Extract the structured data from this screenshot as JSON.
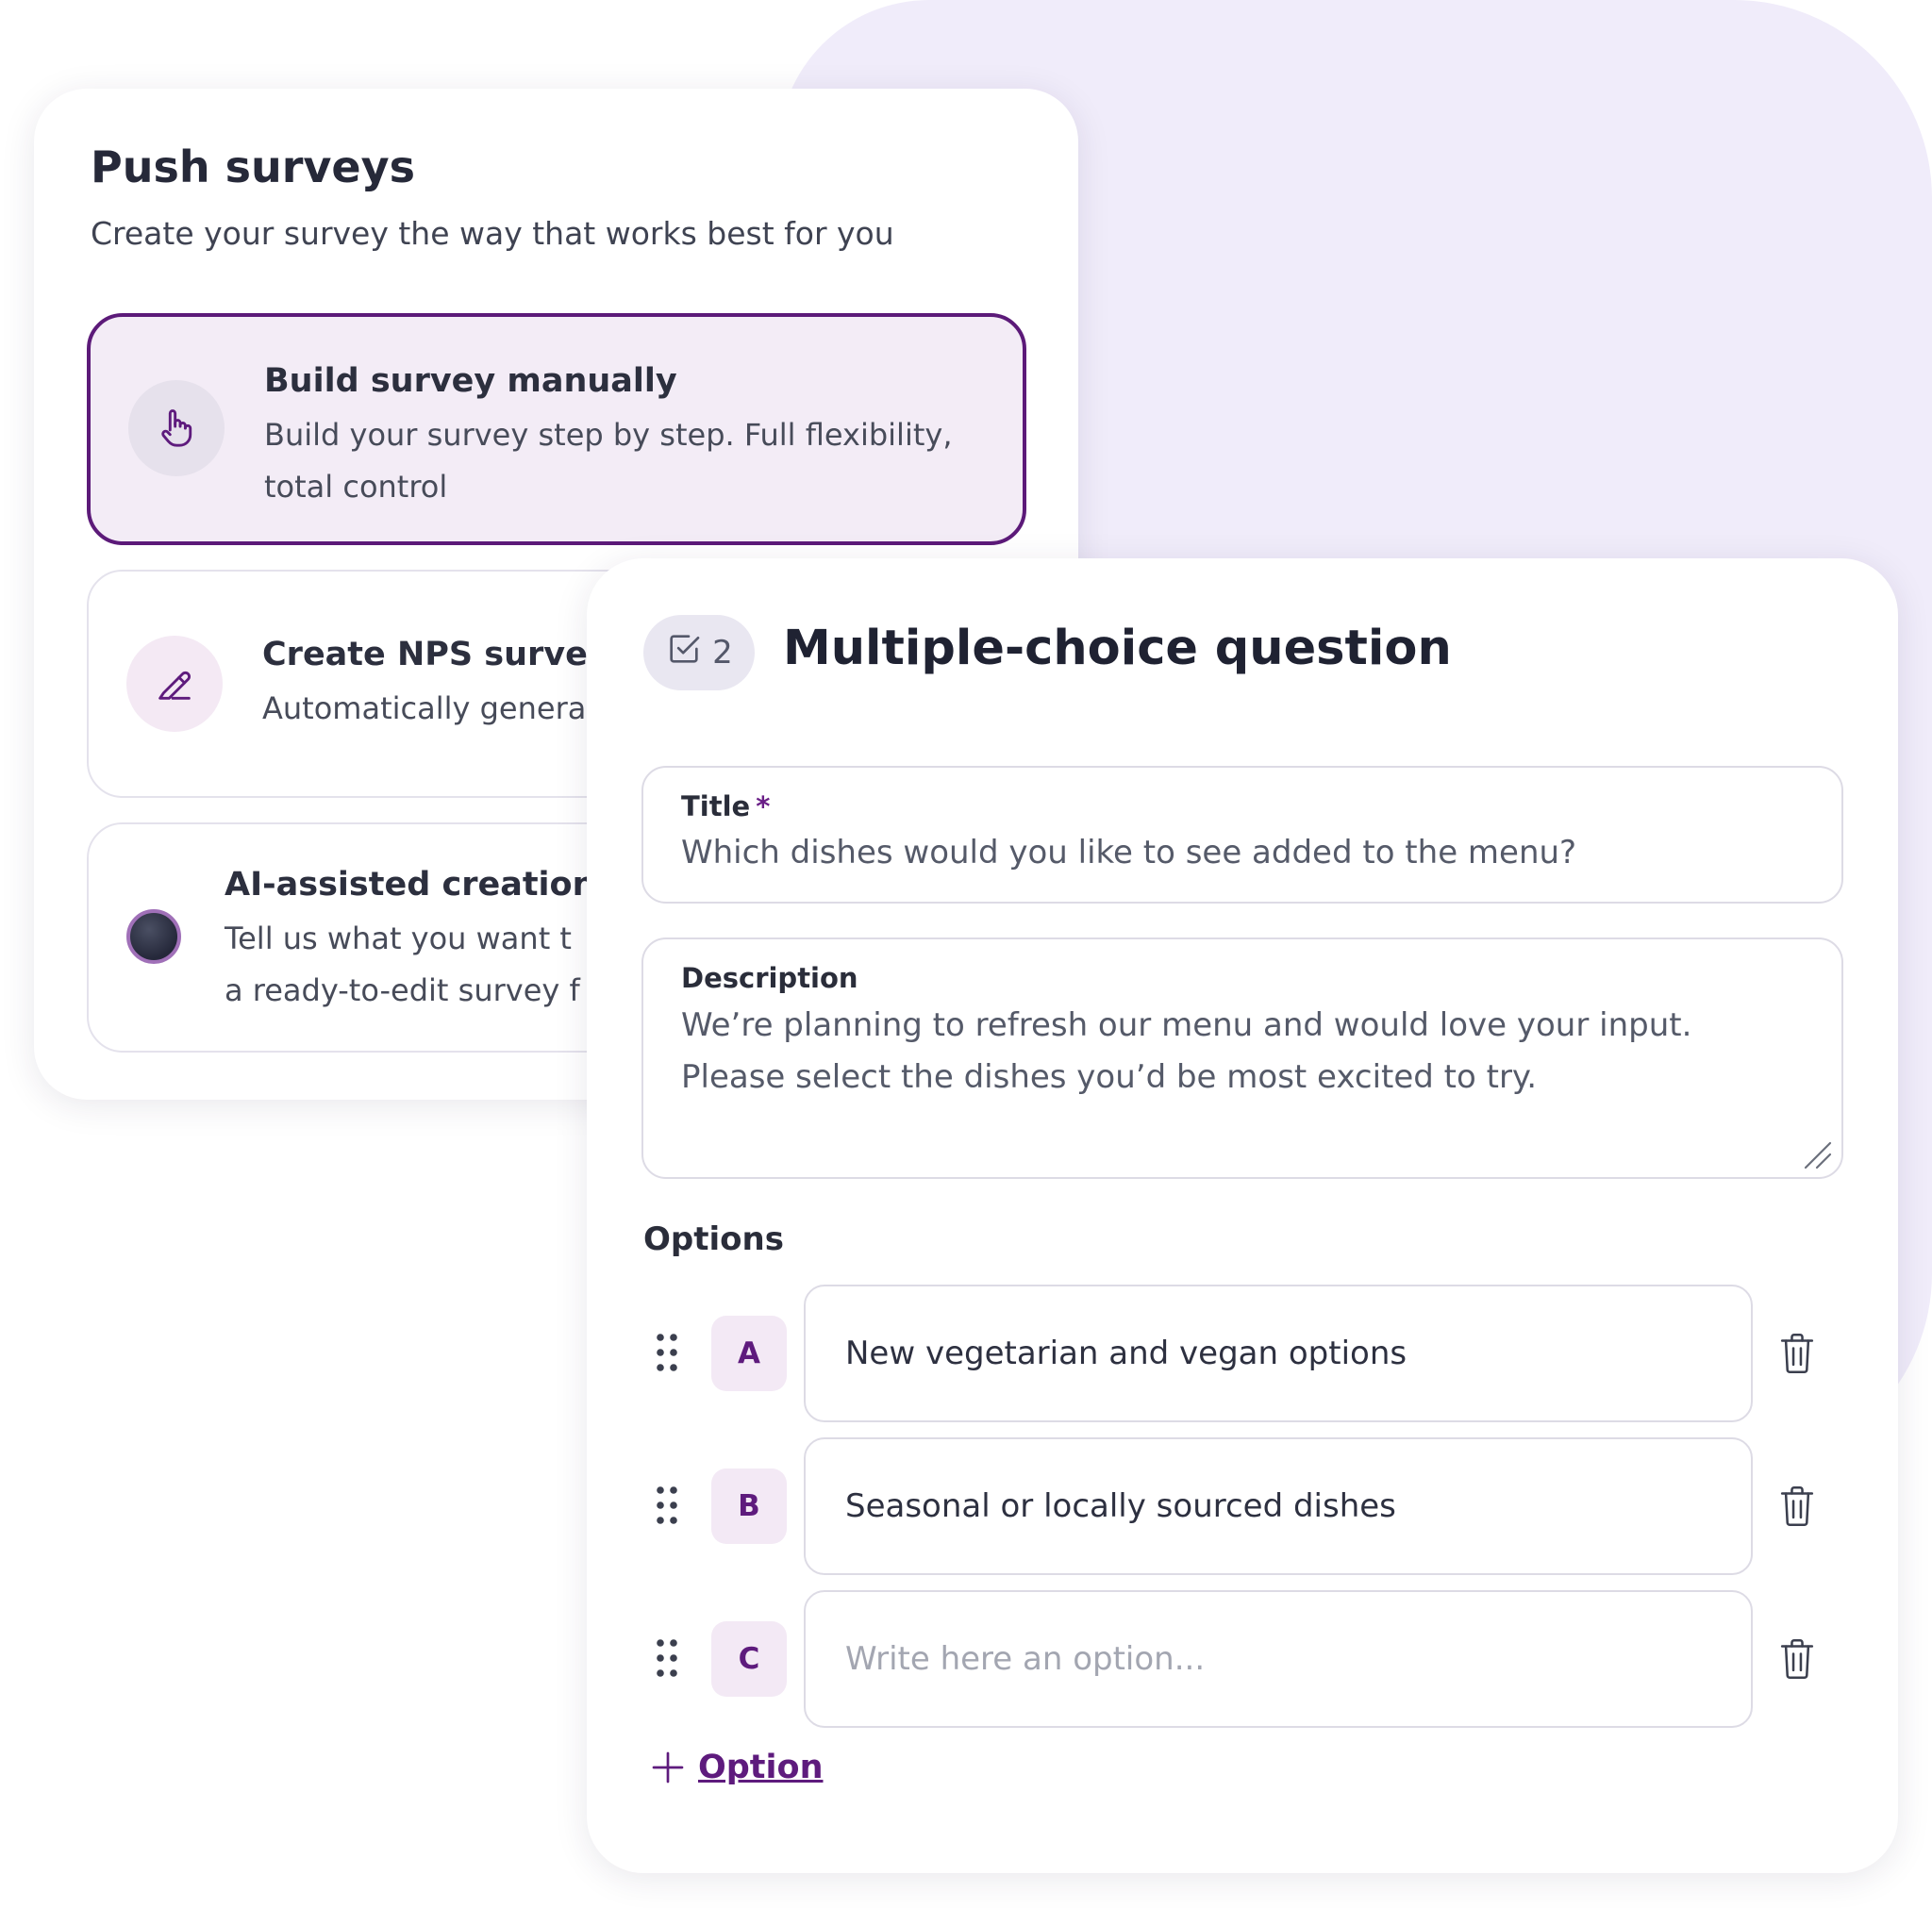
{
  "panel": {
    "title": "Push surveys",
    "subtitle": "Create your survey the way that works best for you",
    "options": [
      {
        "title": "Build survey manually",
        "desc_lines": [
          "Build your survey step by step. Full flexibility,",
          "total control"
        ]
      },
      {
        "title": "Create NPS survey",
        "desc_lines": [
          "Automatically genera"
        ]
      },
      {
        "title": "AI-assisted creation",
        "desc_lines": [
          "Tell us what you want t",
          "a ready-to-edit survey f"
        ]
      }
    ]
  },
  "question": {
    "number": "2",
    "type_title": "Multiple-choice question",
    "title_field": {
      "label": "Title",
      "required_mark": "*",
      "value": "Which dishes would you like to see added to the menu?"
    },
    "description_field": {
      "label": "Description",
      "lines": [
        "We’re planning to refresh our menu and would love your input.",
        "Please select the dishes you’d be most excited to try."
      ]
    },
    "options_label": "Options",
    "options": [
      {
        "letter": "A",
        "value": "New vegetarian and vegan options",
        "placeholder": ""
      },
      {
        "letter": "B",
        "value": "Seasonal or locally sourced dishes",
        "placeholder": ""
      },
      {
        "letter": "C",
        "value": "",
        "placeholder": "Write here an option..."
      }
    ],
    "add_option_label": "Option"
  },
  "colors": {
    "accent": "#5e1b7d",
    "background_blob": "#f0ecfa",
    "selected_option_bg": "#f3ecf6"
  }
}
